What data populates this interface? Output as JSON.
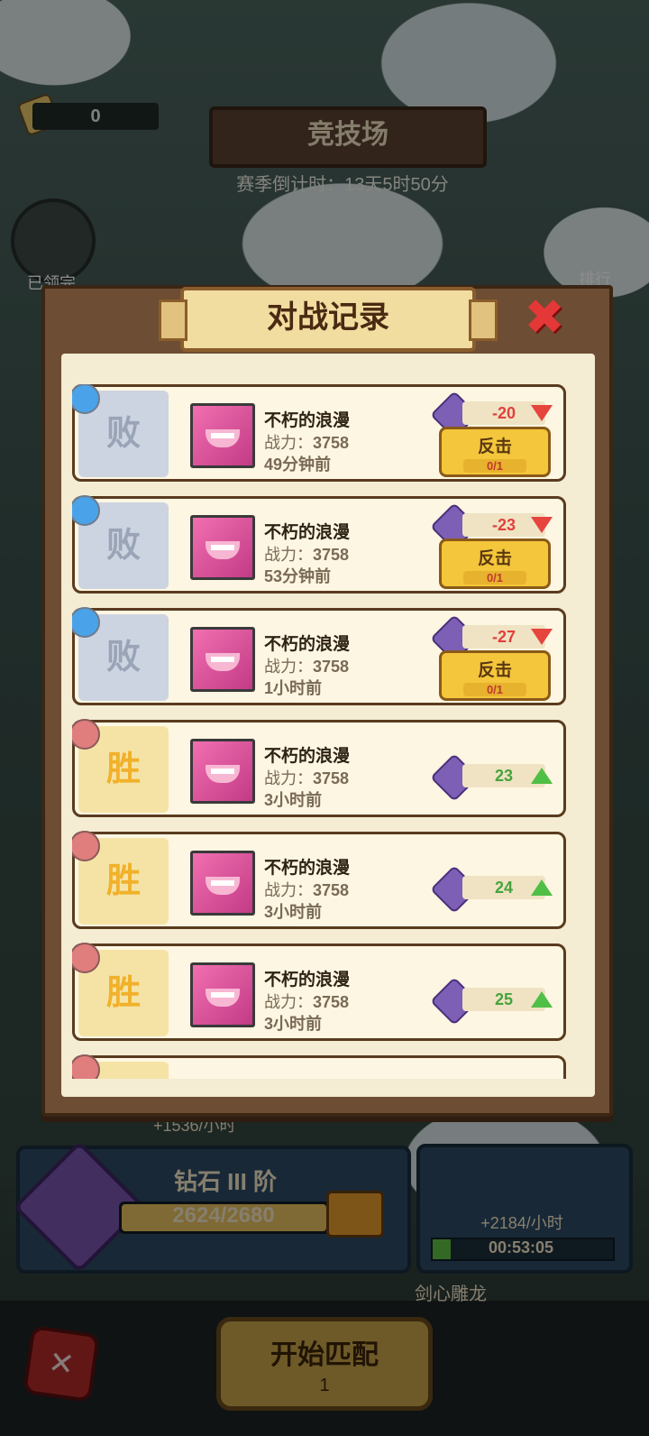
{
  "hud": {
    "scroll_count": "0",
    "arena_title": "竞技场",
    "season_countdown": "赛季倒计时：13天5时50分",
    "claimed_label": "已领完",
    "rank_label": "排行"
  },
  "modal": {
    "title": "对战记录",
    "close_icon": "close-x-icon"
  },
  "records": [
    {
      "result": "败",
      "name": "不朽的浪漫",
      "power_label": "战力：",
      "power": "3758",
      "time": "49分钟前",
      "delta": "-20",
      "trend": "down",
      "counter_label": "反击",
      "counter_cost": "0/1"
    },
    {
      "result": "败",
      "name": "不朽的浪漫",
      "power_label": "战力：",
      "power": "3758",
      "time": "53分钟前",
      "delta": "-23",
      "trend": "down",
      "counter_label": "反击",
      "counter_cost": "0/1"
    },
    {
      "result": "败",
      "name": "不朽的浪漫",
      "power_label": "战力：",
      "power": "3758",
      "time": "1小时前",
      "delta": "-27",
      "trend": "down",
      "counter_label": "反击",
      "counter_cost": "0/1"
    },
    {
      "result": "胜",
      "name": "不朽的浪漫",
      "power_label": "战力：",
      "power": "3758",
      "time": "3小时前",
      "delta": "23",
      "trend": "up"
    },
    {
      "result": "胜",
      "name": "不朽的浪漫",
      "power_label": "战力：",
      "power": "3758",
      "time": "3小时前",
      "delta": "24",
      "trend": "up"
    },
    {
      "result": "胜",
      "name": "不朽的浪漫",
      "power_label": "战力：",
      "power": "3758",
      "time": "3小时前",
      "delta": "25",
      "trend": "up"
    }
  ],
  "footer": {
    "income_left": "+1536/小时",
    "rank_name": "钻石 III 阶",
    "rank_progress_text": "2624/2680",
    "rank_progress": 0.979,
    "idle_income": "+2184/小时",
    "idle_timer": "00:53:05",
    "idle_progress": 0.1,
    "team_name": "剑心雕龙",
    "match_label": "开始匹配",
    "match_cost": "1"
  },
  "colors": {
    "lose_panel": "#cdd4e1",
    "win_panel": "#f5e3a6",
    "delta_negative": "#e2403b",
    "delta_positive": "#47a33c",
    "counter_button": "#f4c63b"
  }
}
